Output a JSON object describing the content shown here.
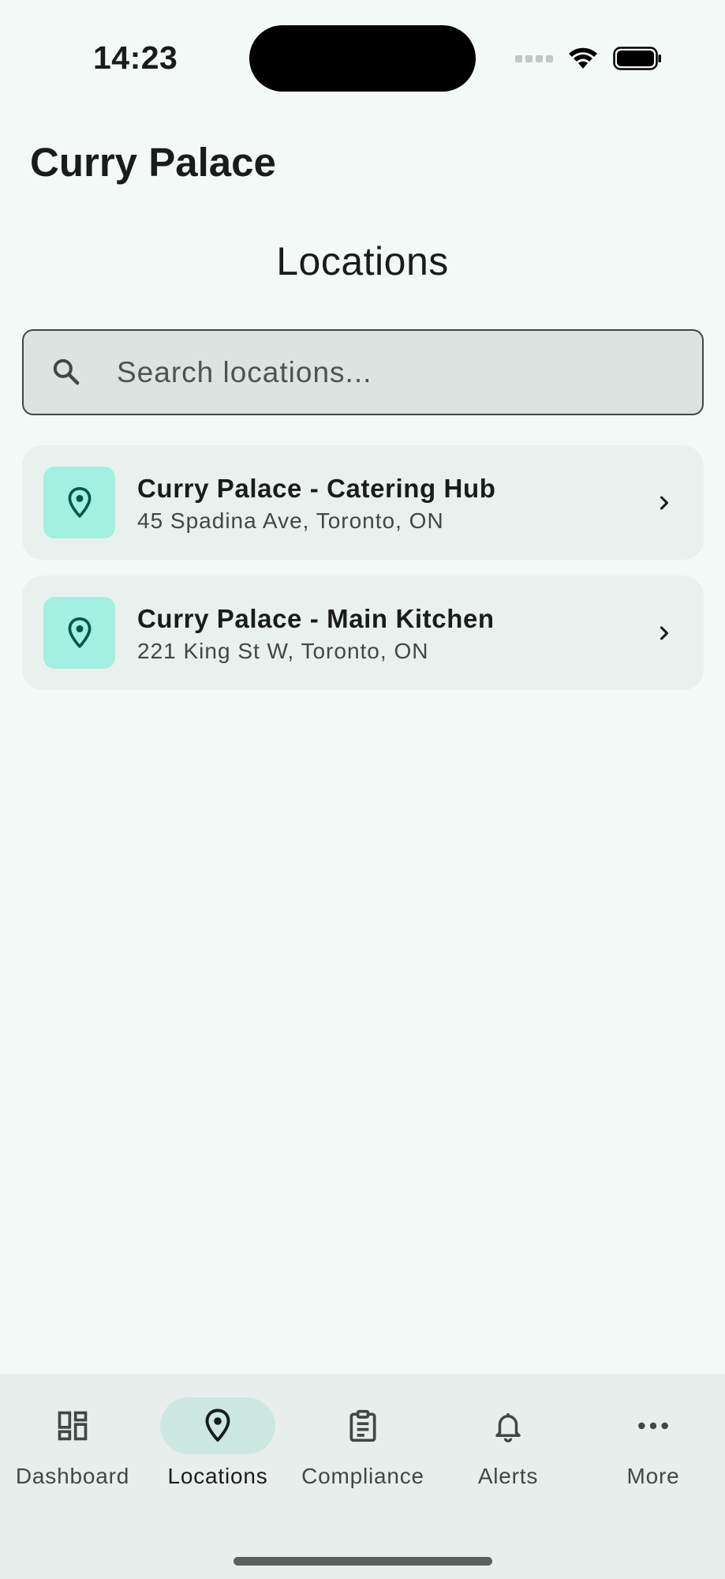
{
  "status_bar": {
    "time": "14:23"
  },
  "app": {
    "title": "Curry Palace"
  },
  "page": {
    "heading": "Locations"
  },
  "search": {
    "placeholder": "Search locations...",
    "value": ""
  },
  "locations": [
    {
      "name": "Curry Palace - Catering Hub",
      "address": "45 Spadina Ave, Toronto, ON",
      "icon": "map-pin-icon"
    },
    {
      "name": "Curry Palace - Main Kitchen",
      "address": "221 King St W, Toronto, ON",
      "icon": "map-pin-icon"
    }
  ],
  "nav": {
    "items": [
      {
        "label": "Dashboard",
        "icon": "dashboard-icon",
        "active": false
      },
      {
        "label": "Locations",
        "icon": "map-pin-icon",
        "active": true
      },
      {
        "label": "Compliance",
        "icon": "clipboard-icon",
        "active": false
      },
      {
        "label": "Alerts",
        "icon": "bell-icon",
        "active": false
      },
      {
        "label": "More",
        "icon": "more-horizontal-icon",
        "active": false
      }
    ]
  },
  "colors": {
    "background": "#f3f9f7",
    "card": "#e9f1ef",
    "accent_container": "#a3f0e2",
    "accent": "#006b5e",
    "nav_active_pill": "#cce8e1",
    "nav_background": "#e8eeec"
  }
}
